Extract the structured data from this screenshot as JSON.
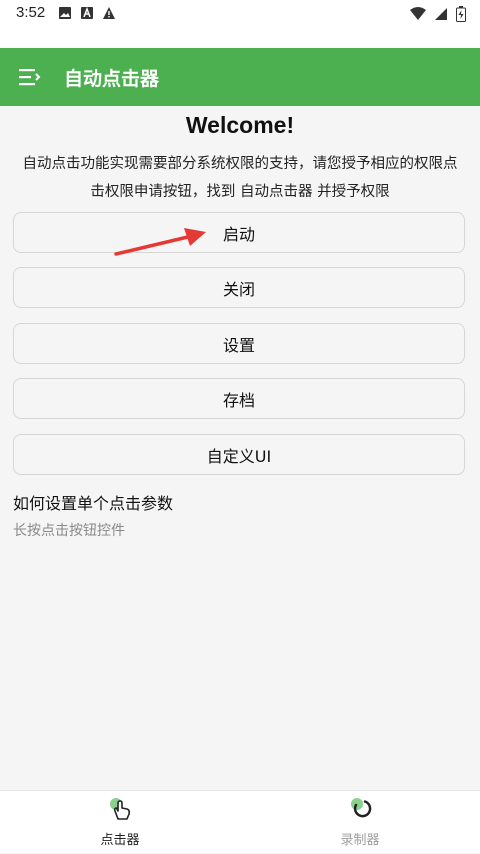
{
  "status": {
    "time": "3:52",
    "left_icons": [
      "image-icon",
      "font-icon",
      "warning-icon"
    ],
    "right_icons": [
      "wifi-icon",
      "signal-icon",
      "battery-icon"
    ]
  },
  "app_bar": {
    "title": "自动点击器",
    "color": "#4caf50",
    "menu_icon": "menu-icon"
  },
  "main": {
    "welcome": "Welcome!",
    "description": "自动点击功能实现需要部分系统权限的支持，请您授予相应的权限点击权限申请按钮，找到 自动点击器 并授予权限",
    "buttons": [
      {
        "label": "启动"
      },
      {
        "label": "关闭"
      },
      {
        "label": "设置"
      },
      {
        "label": "存档"
      },
      {
        "label": "自定义UI"
      }
    ],
    "help_title": "如何设置单个点击参数",
    "help_text": "长按点击按钮控件"
  },
  "bottom_nav": {
    "items": [
      {
        "label": "点击器",
        "icon": "tap-icon",
        "active": true
      },
      {
        "label": "录制器",
        "icon": "record-icon",
        "active": false
      }
    ],
    "active_color": "#222222",
    "inactive_color": "#9e9e9e"
  }
}
